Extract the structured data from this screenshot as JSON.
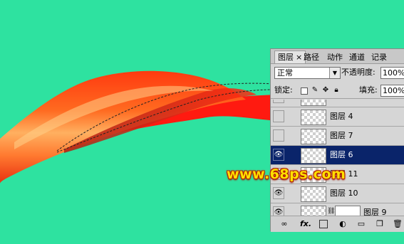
{
  "watermark": "www.68ps.com",
  "panel": {
    "tabs": [
      {
        "label": "图层",
        "active": true
      },
      {
        "label": "路径"
      },
      {
        "label": "动作"
      },
      {
        "label": "通道"
      },
      {
        "label": "记录"
      }
    ],
    "close_glyph": "×",
    "blend_mode": "正常",
    "opacity_label": "不透明度:",
    "opacity_value": "100%",
    "lock_label": "锁定:",
    "fill_label": "填充:",
    "fill_value": "100%",
    "layers": [
      {
        "name": "",
        "visible": false,
        "partial": true
      },
      {
        "name": "图层 4",
        "visible": false
      },
      {
        "name": "图层 7",
        "visible": false
      },
      {
        "name": "图层 6",
        "visible": true,
        "selected": true
      },
      {
        "name": "图层 11",
        "visible": true
      },
      {
        "name": "图层 10",
        "visible": true
      },
      {
        "name": "图层 9",
        "visible": true,
        "has_mask": true
      }
    ],
    "bottom_icons": [
      "link-icon",
      "fx-icon",
      "mask-icon",
      "adjustment-icon",
      "folder-icon",
      "new-layer-icon",
      "trash-icon"
    ]
  },
  "colors": {
    "background": "#2ee2a0",
    "selection": "#0a246a",
    "watermark": "#ffe000"
  }
}
